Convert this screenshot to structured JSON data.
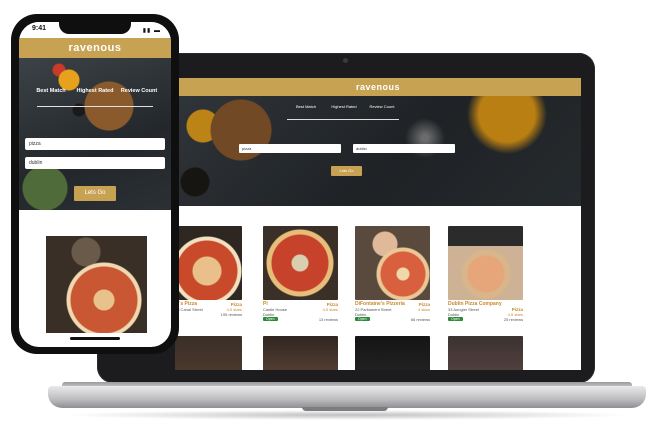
{
  "laptop": {
    "brand": "ravenous",
    "tabs": [
      "Best Match",
      "Highest Rated",
      "Review Count"
    ],
    "search_value": "pizza",
    "location_value": "dublin",
    "button_label": "Lets Go",
    "cards": [
      {
        "name": "le's Pizza",
        "address": "nd Canal Street",
        "city": "",
        "category": "Pizza",
        "rating": "4.5 stars",
        "status": "",
        "reviews": "195 reviews"
      },
      {
        "name": "Pi",
        "address": "Castle House",
        "city": "Dublin",
        "category": "Pizza",
        "rating": "4.5 stars",
        "status": "Open",
        "reviews": "13 reviews"
      },
      {
        "name": "DiFontaine's Pizzeria",
        "address": "22 Parliament Street",
        "city": "Dublin",
        "category": "Pizza",
        "rating": "4 stars",
        "status": "Open",
        "reviews": "66 reviews"
      },
      {
        "name": "Dublin Pizza Company",
        "address": "33 Aungier Street",
        "city": "Dublin",
        "category": "Pizza",
        "rating": "4.5 stars",
        "status": "Open",
        "reviews": "25 reviews"
      }
    ]
  },
  "phone": {
    "time": "9:41",
    "brand": "ravenous",
    "tabs": [
      "Best Match",
      "Highest Rated",
      "Review Count"
    ],
    "search_value": "pizza",
    "location_value": "dublin",
    "button_label": "Lets Go"
  },
  "colors": {
    "accent": "#c7a253",
    "open": "#2d8a3a",
    "name": "#c7882e"
  }
}
